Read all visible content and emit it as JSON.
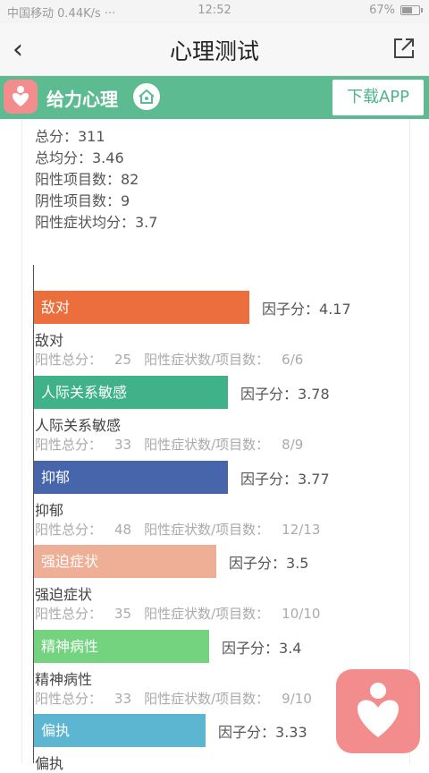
{
  "status_bar": {
    "carrier": "中国移动",
    "network": "0.44K/s ···",
    "time": "12:52",
    "battery": "67%",
    "battery_level": 0.67
  },
  "header": {
    "back_icon": "back-chevron-icon",
    "title": "心理测试",
    "share_icon": "share-icon"
  },
  "banner": {
    "brand": "给力心理",
    "download_label": "下载APP",
    "colors": {
      "bg": "#5dbb91",
      "logo": "#f38d8d"
    }
  },
  "summary": {
    "total": "总分：311",
    "average": "总均分：3.46",
    "positive_items": "阳性项目数：82",
    "negative_items": "阴性项目数：9",
    "positive_avg": "阳性症状均分：3.7"
  },
  "factor_labels": {
    "score_prefix": "因子分：",
    "positive_total_prefix": "阳性总分：",
    "ratio_prefix": "阳性症状数/项目数："
  },
  "factors": [
    {
      "label": "敌对",
      "score": "4.17",
      "positive_total": "25",
      "ratio": "6/6",
      "color": "#ec6e3d",
      "bar_fraction": 0.56
    },
    {
      "label": "人际关系敏感",
      "score": "3.78",
      "positive_total": "33",
      "ratio": "8/9",
      "color": "#3fb28a",
      "bar_fraction": 0.505
    },
    {
      "label": "抑郁",
      "score": "3.77",
      "positive_total": "48",
      "ratio": "12/13",
      "color": "#4765ab",
      "bar_fraction": 0.505
    },
    {
      "label": "强迫症状",
      "score": "3.5",
      "positive_total": "35",
      "ratio": "10/10",
      "color": "#efae96",
      "bar_fraction": 0.475
    },
    {
      "label": "精神病性",
      "score": "3.4",
      "positive_total": "33",
      "ratio": "9/10",
      "color": "#73d37f",
      "bar_fraction": 0.455
    },
    {
      "label": "偏执",
      "score": "3.33",
      "positive_total": "",
      "ratio": "",
      "color": "#5cb5d1",
      "bar_fraction": 0.447
    }
  ]
}
